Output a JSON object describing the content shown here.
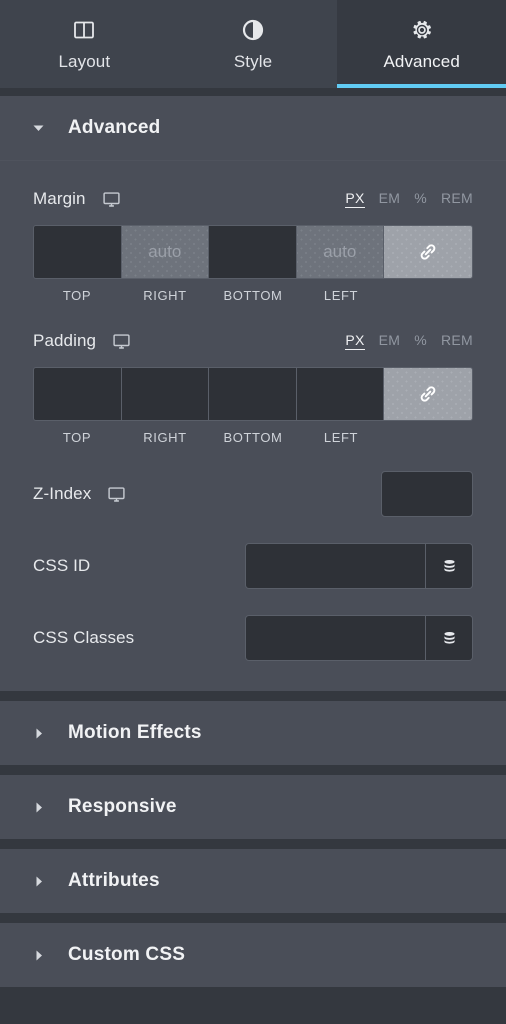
{
  "tabs": [
    {
      "id": "layout",
      "label": "Layout",
      "icon": "columns-icon",
      "active": false
    },
    {
      "id": "style",
      "label": "Style",
      "icon": "contrast-icon",
      "active": false
    },
    {
      "id": "advanced",
      "label": "Advanced",
      "icon": "gear-icon",
      "active": true
    }
  ],
  "accent_color": "#61CBF4",
  "panel_bg": "#4A4E58",
  "page_bg": "#34383F",
  "field_bg": "#2E3137",
  "advanced_section": {
    "title": "Advanced",
    "expanded": true,
    "caret": "caret-down-icon",
    "margin": {
      "label": "Margin",
      "device_icon": "desktop-icon",
      "units": [
        {
          "label": "PX",
          "active": true
        },
        {
          "label": "EM",
          "active": false
        },
        {
          "label": "%",
          "active": false
        },
        {
          "label": "REM",
          "active": false
        }
      ],
      "fields": [
        {
          "name": "top",
          "sublabel": "TOP",
          "value": "",
          "placeholder": "",
          "highlighted": false
        },
        {
          "name": "right",
          "sublabel": "RIGHT",
          "value": "",
          "placeholder": "auto",
          "highlighted": true
        },
        {
          "name": "bottom",
          "sublabel": "BOTTOM",
          "value": "",
          "placeholder": "",
          "highlighted": false
        },
        {
          "name": "left",
          "sublabel": "LEFT",
          "value": "",
          "placeholder": "auto",
          "highlighted": true
        }
      ],
      "link_icon": "link-icon",
      "link_active": true
    },
    "padding": {
      "label": "Padding",
      "device_icon": "desktop-icon",
      "units": [
        {
          "label": "PX",
          "active": true
        },
        {
          "label": "EM",
          "active": false
        },
        {
          "label": "%",
          "active": false
        },
        {
          "label": "REM",
          "active": false
        }
      ],
      "fields": [
        {
          "name": "top",
          "sublabel": "TOP",
          "value": "",
          "placeholder": "",
          "highlighted": false
        },
        {
          "name": "right",
          "sublabel": "RIGHT",
          "value": "",
          "placeholder": "",
          "highlighted": false
        },
        {
          "name": "bottom",
          "sublabel": "BOTTOM",
          "value": "",
          "placeholder": "",
          "highlighted": false
        },
        {
          "name": "left",
          "sublabel": "LEFT",
          "value": "",
          "placeholder": "",
          "highlighted": false
        }
      ],
      "link_icon": "link-icon",
      "link_active": true
    },
    "z_index": {
      "label": "Z-Index",
      "device_icon": "desktop-icon",
      "value": "",
      "placeholder": ""
    },
    "css_id": {
      "label": "CSS ID",
      "value": "",
      "placeholder": "",
      "dynamic_icon": "database-icon"
    },
    "css_classes": {
      "label": "CSS Classes",
      "value": "",
      "placeholder": "",
      "dynamic_icon": "database-icon"
    }
  },
  "collapsed_sections": [
    {
      "id": "motion-effects",
      "title": "Motion Effects",
      "caret": "caret-right-icon",
      "expanded": false
    },
    {
      "id": "responsive",
      "title": "Responsive",
      "caret": "caret-right-icon",
      "expanded": false
    },
    {
      "id": "attributes",
      "title": "Attributes",
      "caret": "caret-right-icon",
      "expanded": false
    },
    {
      "id": "custom-css",
      "title": "Custom CSS",
      "caret": "caret-right-icon",
      "expanded": false
    }
  ]
}
